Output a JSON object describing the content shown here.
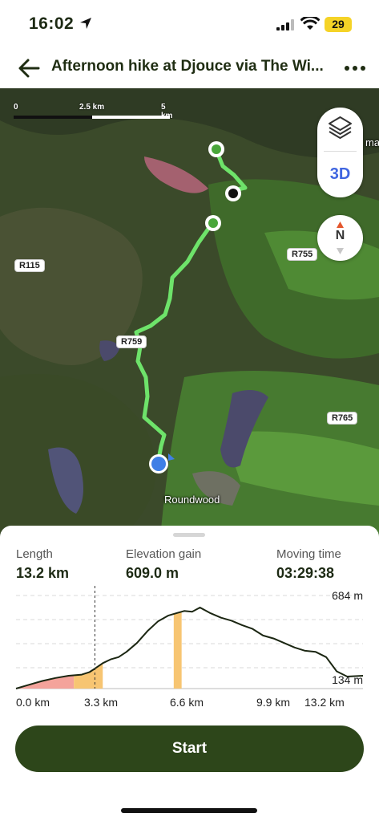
{
  "status": {
    "time": "16:02",
    "battery": "29"
  },
  "header": {
    "title": "Afternoon hike at Djouce via The Wi..."
  },
  "map": {
    "scale": {
      "label_0": "0",
      "label_mid": "2.5 km",
      "label_end": "5 km"
    },
    "controls": {
      "threed_label": "3D",
      "compass_label": "N"
    },
    "roads": [
      {
        "label": "R115"
      },
      {
        "label": "R755"
      },
      {
        "label": "R759"
      },
      {
        "label": "R765"
      }
    ],
    "places": {
      "roundwood": "Roundwood",
      "edge": "ma"
    }
  },
  "stats": {
    "length": {
      "label": "Length",
      "value": "13.2 km"
    },
    "elevation": {
      "label": "Elevation gain",
      "value": "609.0 m"
    },
    "moving": {
      "label": "Moving time",
      "value": "03:29:38"
    }
  },
  "chart_data": {
    "type": "area",
    "title": "",
    "xlabel": "",
    "ylabel": "",
    "x_ticks": [
      "0.0 km",
      "3.3 km",
      "6.6 km",
      "9.9 km",
      "13.2 km"
    ],
    "y_labels": {
      "max": "684 m",
      "min": "134 m"
    },
    "ylim": [
      134,
      684
    ],
    "xlim": [
      0,
      13.2
    ],
    "x": [
      0,
      0.5,
      1.0,
      1.5,
      2.0,
      2.5,
      2.8,
      3.0,
      3.3,
      3.6,
      3.9,
      4.2,
      4.6,
      5.0,
      5.4,
      5.8,
      6.1,
      6.4,
      6.7,
      7.0,
      7.4,
      7.8,
      8.2,
      8.6,
      9.0,
      9.4,
      9.8,
      10.2,
      10.6,
      11.0,
      11.4,
      11.8,
      12.2,
      12.6,
      13.2
    ],
    "y": [
      134,
      160,
      185,
      205,
      220,
      228,
      245,
      268,
      305,
      330,
      345,
      380,
      440,
      520,
      585,
      625,
      640,
      655,
      650,
      678,
      640,
      610,
      590,
      560,
      535,
      490,
      470,
      440,
      410,
      388,
      380,
      345,
      250,
      215,
      220
    ],
    "cursor_x": 3.0,
    "highlight_segments": [
      {
        "from": 0,
        "to": 2.2,
        "color": "#f4a39b"
      },
      {
        "from": 2.2,
        "to": 3.3,
        "color": "#f7c572"
      },
      {
        "from": 6.0,
        "to": 6.3,
        "color": "#f7c572"
      }
    ],
    "line_color": "#1b2612",
    "grid": true
  },
  "actions": {
    "start_label": "Start"
  },
  "colors": {
    "brand_dark": "#2d461a",
    "route": "#6ee36a",
    "accent_blue": "#4066e0"
  }
}
